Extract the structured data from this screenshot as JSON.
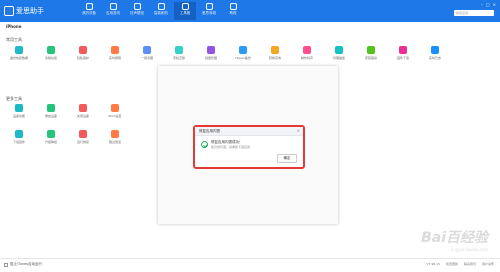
{
  "app": {
    "name": "爱思助手",
    "search_placeholder": "搜索应用"
  },
  "nav": [
    {
      "label": "我的设备",
      "icon": "device-icon"
    },
    {
      "label": "应用游戏",
      "icon": "apps-icon"
    },
    {
      "label": "铃声壁纸",
      "icon": "ringtone-icon"
    },
    {
      "label": "智能刷机",
      "icon": "flash-icon"
    },
    {
      "label": "工具箱",
      "icon": "toolbox-icon"
    },
    {
      "label": "爱思商城",
      "icon": "store-icon"
    },
    {
      "label": "教程",
      "icon": "tutorial-icon"
    }
  ],
  "active_nav": "工具箱",
  "device": {
    "name": "iPhone"
  },
  "sections": {
    "common": "常用工具",
    "more": "更多工具"
  },
  "tools_row1": [
    "备份恢复数据",
    "清除垃圾",
    "隐私保护",
    "实时屏幕",
    "一键清理",
    "手机迁移",
    "批量管理",
    "iTunes备份",
    "转换高效",
    "制作铃声",
    "管理描述",
    "安装驱动",
    "固件下载",
    "实时日志"
  ],
  "tools_row2": [
    "设备功能",
    "重启设备",
    "关闭设备",
    "IPCC设置"
  ],
  "tools_row3": [
    "下载固件",
    "升级降级",
    "运行恢复",
    "跳过激活"
  ],
  "dialog": {
    "title": "修复应用闪退",
    "close_glyph": "×",
    "message": "修复应用闪退成功！",
    "sub_message": "如仍然闪退，请重新下载应用",
    "ok_label": "确定",
    "highlight_color": "#e53935"
  },
  "status": {
    "checkbox_label": "阻止iTunes自动运行",
    "version": "V7.98.15",
    "links": [
      "检查更新",
      "联系我们",
      "用户关怀"
    ]
  },
  "watermark": {
    "text": "Bai百经验",
    "sub": "jingyan.baidu.com"
  },
  "colors": {
    "primary": "#1f78e8",
    "tool_colors": [
      "#1fb8c9",
      "#27c27b",
      "#f25b5b",
      "#ff7a45",
      "#5b8ff9",
      "#36cfc9",
      "#9254de",
      "#2f9bf7",
      "#f5a623",
      "#ff4d8f",
      "#13c2c2",
      "#52c41a",
      "#eb2f96",
      "#1890ff"
    ]
  }
}
